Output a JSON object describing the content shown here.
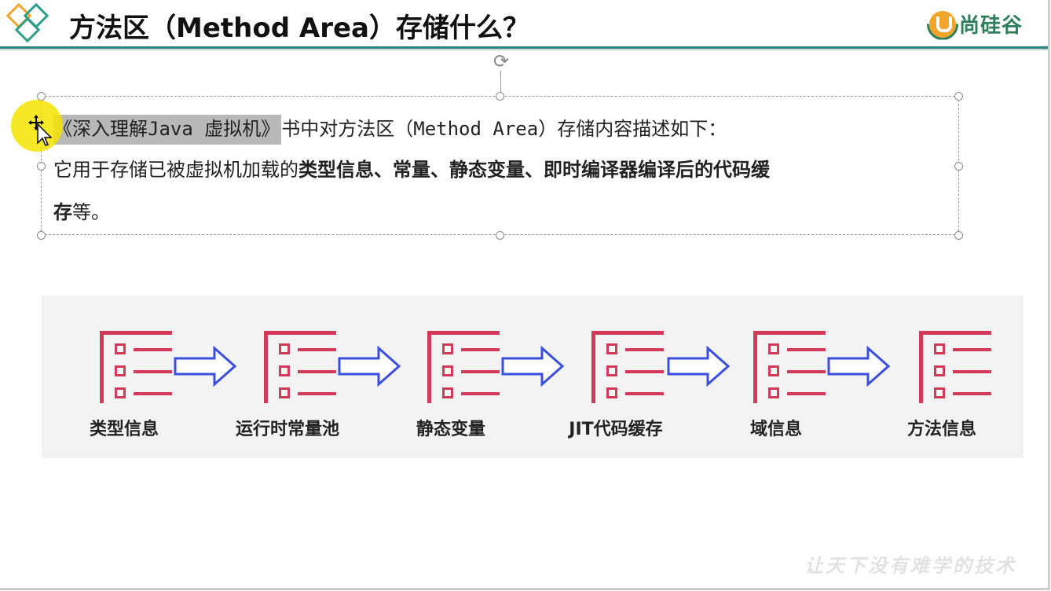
{
  "title": "方法区（Method Area）存储什么？",
  "brand": {
    "name": "尚硅谷",
    "icon": "u-logo-icon"
  },
  "textbox": {
    "line1_selected": "《深入理解Java 虚拟机》",
    "line1_rest": "书中对方法区（Method Area）存储内容描述如下：",
    "line2_normal": "它用于存储已被虚拟机加载的",
    "line2_bold": "类型信息、常量、静态变量、即时编译器编译后的代码缓",
    "line3_bold": "存",
    "line3_normal": "等。"
  },
  "flow": {
    "steps": [
      {
        "label": "类型信息"
      },
      {
        "label": "运行时常量池"
      },
      {
        "label": "静态变量"
      },
      {
        "label": "JIT代码缓存"
      },
      {
        "label": "域信息"
      },
      {
        "label": "方法信息"
      }
    ],
    "icon": "list-icon",
    "arrow_icon": "right-arrow-icon",
    "accent_color": "#d23a5a",
    "arrow_color": "#3a4fe0"
  },
  "watermark": "让天下没有难学的技术",
  "colors": {
    "title_rule": "#2e7d7a",
    "brand": "#2e7d5b",
    "cursor_halo": "#f5e400"
  }
}
